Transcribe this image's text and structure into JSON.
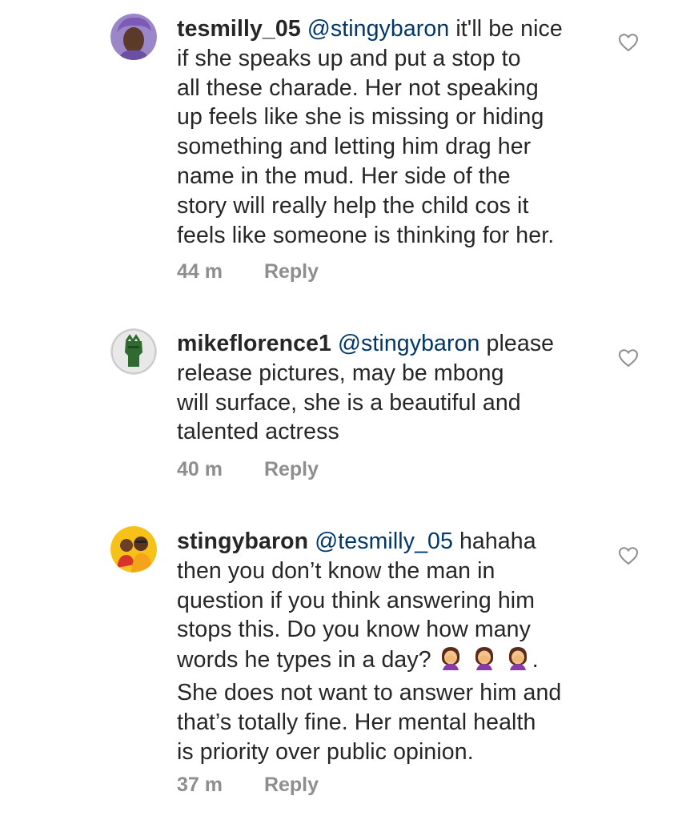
{
  "comments": [
    {
      "username": "tesmilly_05",
      "mention": "@stingybaron",
      "lines": [
        "it'll be nice",
        "if she speaks up and put a stop to",
        "all these charade. Her not speaking",
        "up feels like she is missing or hiding",
        "something and letting him drag her",
        "name in the mud. Her side of the",
        "story will really help the child cos it",
        "feels like someone is thinking for her."
      ],
      "time": "44 m",
      "reply": "Reply",
      "avatar_icon": "avatar-purple-headwrap"
    },
    {
      "username": "mikeflorence1",
      "mention": "@stingybaron",
      "lines": [
        "please",
        "release pictures, may be mbong",
        "will surface, she is a beautiful and",
        "talented actress"
      ],
      "time": "40 m",
      "reply": "Reply",
      "avatar_icon": "avatar-green-fist"
    },
    {
      "username": "stingybaron",
      "mention": "@tesmilly_05",
      "lines": [
        "hahaha",
        "then you don’t know the man in",
        "question if you think answering him",
        "stops this. Do you know how many",
        "words he types in a day?",
        "She does not want to answer him and",
        "that’s totally fine. Her mental health",
        "is priority over public opinion."
      ],
      "emoji_after_line_index": 4,
      "emoji": "facepalm-woman-emoji",
      "emoji_count": 3,
      "emoji_trailing": ".",
      "time": "37 m",
      "reply": "Reply",
      "avatar_icon": "avatar-two-people-yellow"
    }
  ],
  "colors": {
    "text": "#262626",
    "mention": "#00376b",
    "meta": "#8e8e8e",
    "like_icon": "#8e8e8e"
  }
}
